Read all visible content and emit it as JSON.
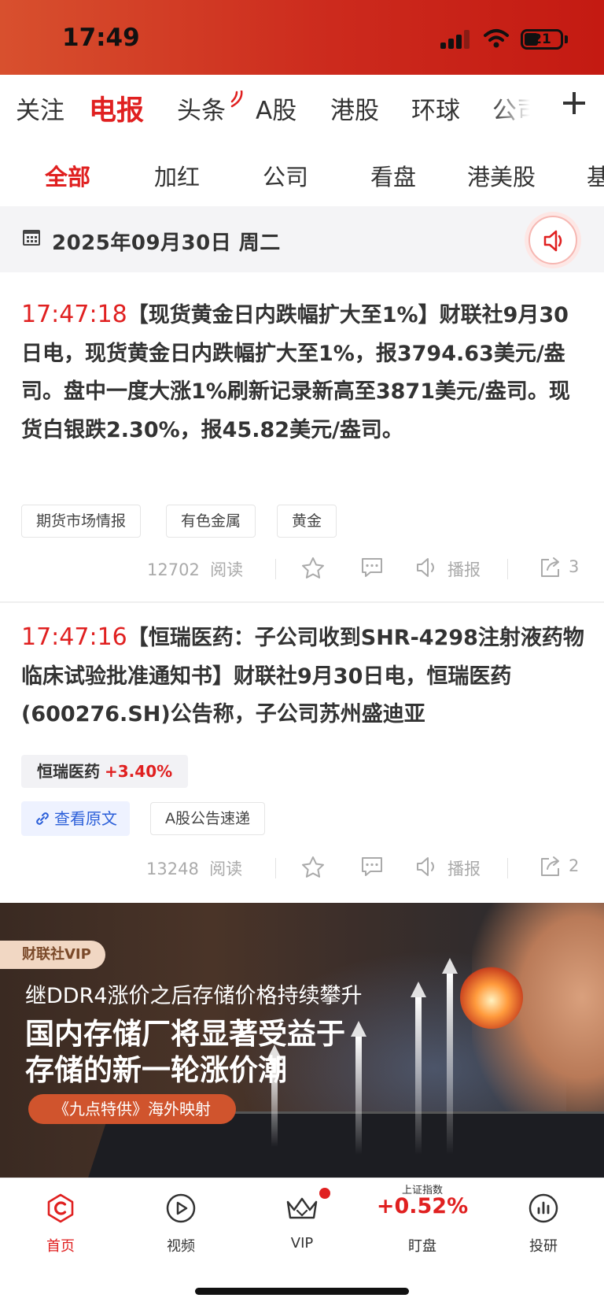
{
  "status_bar": {
    "time": "17:49",
    "battery": "21"
  },
  "main_tabs": [
    "关注",
    "电报",
    "头条",
    "A股",
    "港股",
    "环球",
    "公司"
  ],
  "sub_tabs": [
    "全部",
    "加红",
    "公司",
    "看盘",
    "港美股",
    "基"
  ],
  "date_bar": {
    "date": "2025年09月30日  周二"
  },
  "news": [
    {
      "time": "17:47:18",
      "text": "【现货黄金日内跌幅扩大至1%】财联社9月30日电，现货黄金日内跌幅扩大至1%，报3794.63美元/盎司。盘中一度大涨1%刷新记录新高至3871美元/盎司。现货白银跌2.30%，报45.82美元/盎司。",
      "tags": [
        "期货市场情报",
        "有色金属",
        "黄金"
      ],
      "reads": "12702",
      "read_label": "阅读",
      "broadcast_label": "播报",
      "shares": "3"
    },
    {
      "time": "17:47:16",
      "text": "【恒瑞医药：子公司收到SHR-4298注射液药物临床试验批准通知书】财联社9月30日电，恒瑞医药(600276.SH)公告称，子公司苏州盛迪亚",
      "stock_name": "恒瑞医药",
      "stock_change": "+3.40%",
      "link_label": "查看原文",
      "tags": [
        "A股公告速递"
      ],
      "reads": "13248",
      "read_label": "阅读",
      "broadcast_label": "播报",
      "shares": "2"
    }
  ],
  "banner": {
    "badge": "财联社VIP",
    "line1": "继DDR4涨价之后存储价格持续攀升",
    "line2": "国内存储厂将显著受益于",
    "line3": "存储的新一轮涨价潮",
    "pill": "《九点特供》海外映射"
  },
  "bottom_nav": {
    "home": "首页",
    "video": "视频",
    "vip": "VIP",
    "index_name": "上证指数",
    "index_value": "+0.52%",
    "watch": "盯盘",
    "research": "投研"
  },
  "colors": {
    "accent": "#e02020",
    "link": "#2b5fd9"
  }
}
